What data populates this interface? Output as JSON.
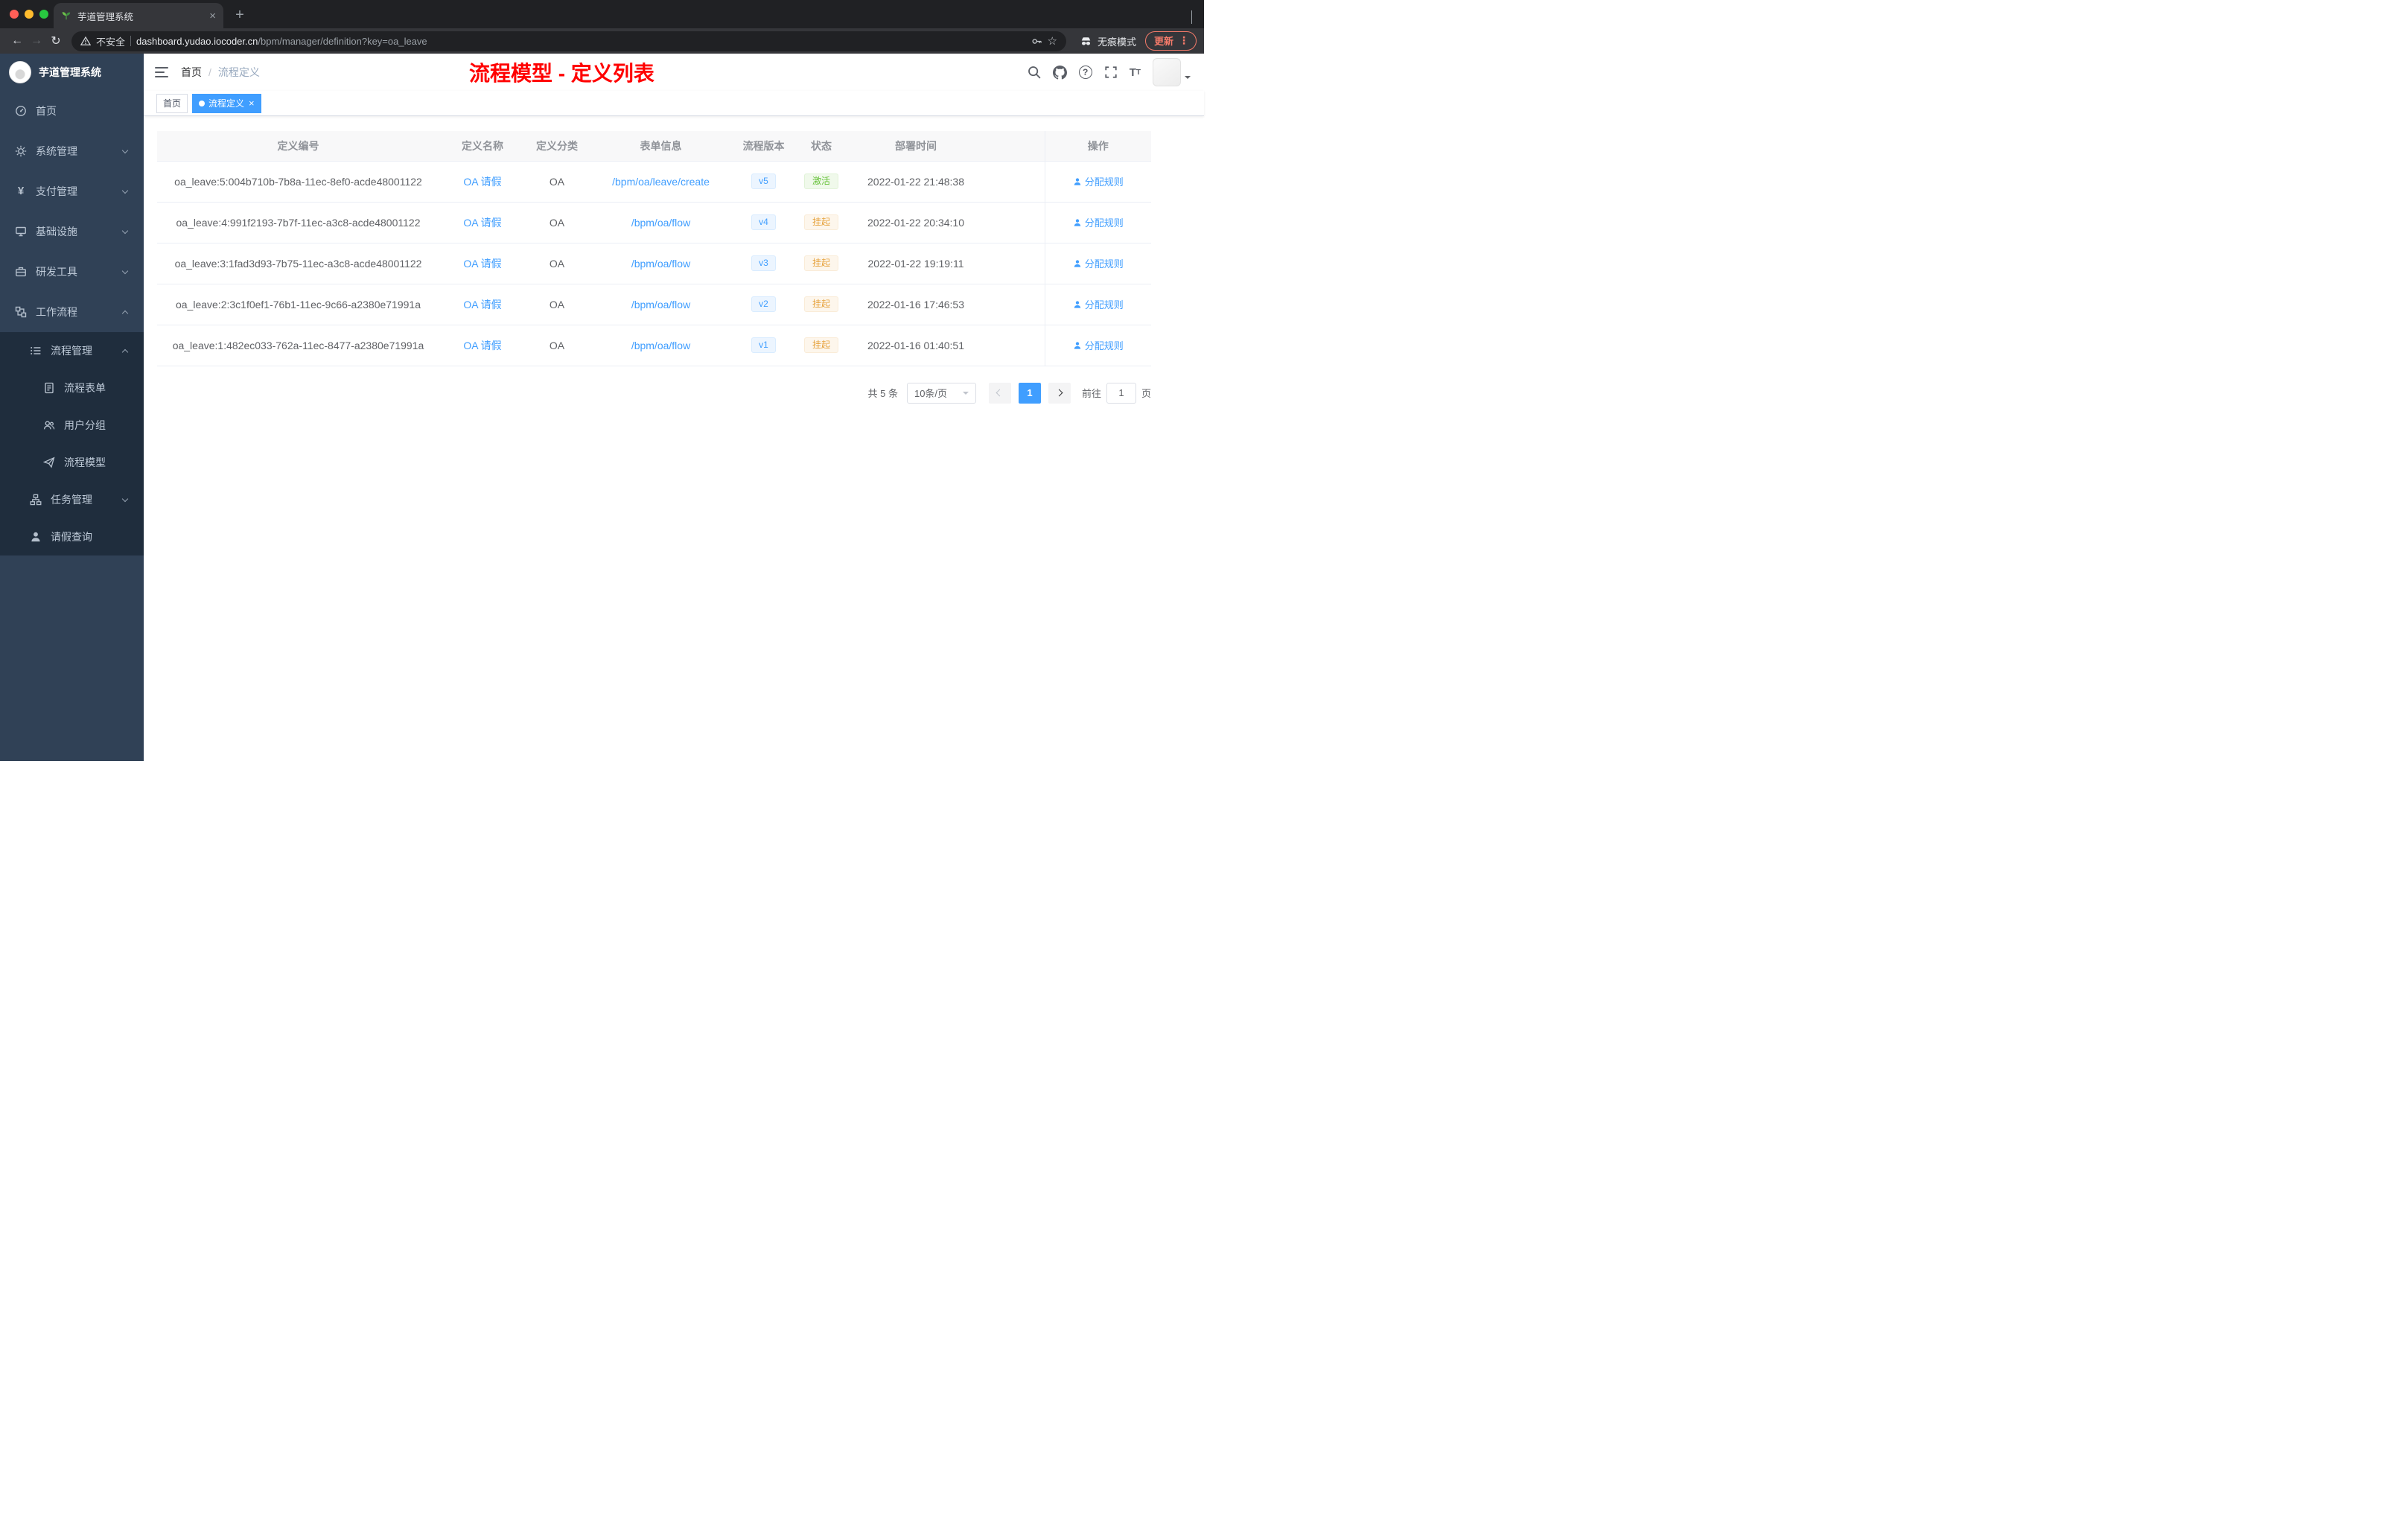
{
  "browser": {
    "tab_title": "芋道管理系统",
    "security_label": "不安全",
    "url_host": "dashboard.yudao.iocoder.cn",
    "url_path": "/bpm/manager/definition?key=oa_leave",
    "incognito_label": "无痕模式",
    "update_label": "更新"
  },
  "sidebar": {
    "logo_title": "芋道管理系统",
    "items": [
      {
        "label": "首页"
      },
      {
        "label": "系统管理"
      },
      {
        "label": "支付管理"
      },
      {
        "label": "基础设施"
      },
      {
        "label": "研发工具"
      },
      {
        "label": "工作流程"
      }
    ],
    "submenu": {
      "process_mgmt_label": "流程管理",
      "children": [
        {
          "label": "流程表单"
        },
        {
          "label": "用户分组"
        },
        {
          "label": "流程模型"
        }
      ],
      "task_mgmt_label": "任务管理",
      "leave_query_label": "请假查询"
    }
  },
  "header": {
    "breadcrumb_home": "首页",
    "breadcrumb_current": "流程定义",
    "annotation_title": "流程模型 - 定义列表",
    "annotation_color": "#ff0000"
  },
  "tags": {
    "home_label": "首页",
    "active_label": "流程定义"
  },
  "table": {
    "columns": [
      "定义编号",
      "定义名称",
      "定义分类",
      "表单信息",
      "流程版本",
      "状态",
      "部署时间",
      "操作"
    ],
    "rows": [
      {
        "id": "oa_leave:5:004b710b-7b8a-11ec-8ef0-acde48001122",
        "name": "OA 请假",
        "category": "OA",
        "form": "/bpm/oa/leave/create",
        "version": "v5",
        "status": "激活",
        "status_type": "success",
        "deploy_time": "2022-01-22 21:48:38",
        "action": "分配规则"
      },
      {
        "id": "oa_leave:4:991f2193-7b7f-11ec-a3c8-acde48001122",
        "name": "OA 请假",
        "category": "OA",
        "form": "/bpm/oa/flow",
        "version": "v4",
        "status": "挂起",
        "status_type": "warning",
        "deploy_time": "2022-01-22 20:34:10",
        "action": "分配规则"
      },
      {
        "id": "oa_leave:3:1fad3d93-7b75-11ec-a3c8-acde48001122",
        "name": "OA 请假",
        "category": "OA",
        "form": "/bpm/oa/flow",
        "version": "v3",
        "status": "挂起",
        "status_type": "warning",
        "deploy_time": "2022-01-22 19:19:11",
        "action": "分配规则"
      },
      {
        "id": "oa_leave:2:3c1f0ef1-76b1-11ec-9c66-a2380e71991a",
        "name": "OA 请假",
        "category": "OA",
        "form": "/bpm/oa/flow",
        "version": "v2",
        "status": "挂起",
        "status_type": "warning",
        "deploy_time": "2022-01-16 17:46:53",
        "action": "分配规则"
      },
      {
        "id": "oa_leave:1:482ec033-762a-11ec-8477-a2380e71991a",
        "name": "OA 请假",
        "category": "OA",
        "form": "/bpm/oa/flow",
        "version": "v1",
        "status": "挂起",
        "status_type": "warning",
        "deploy_time": "2022-01-16 01:40:51",
        "action": "分配规则"
      }
    ]
  },
  "pagination": {
    "total_label": "共 5 条",
    "page_size_label": "10条/页",
    "current_page": "1",
    "goto_label": "前往",
    "goto_value": "1",
    "page_unit": "页"
  }
}
